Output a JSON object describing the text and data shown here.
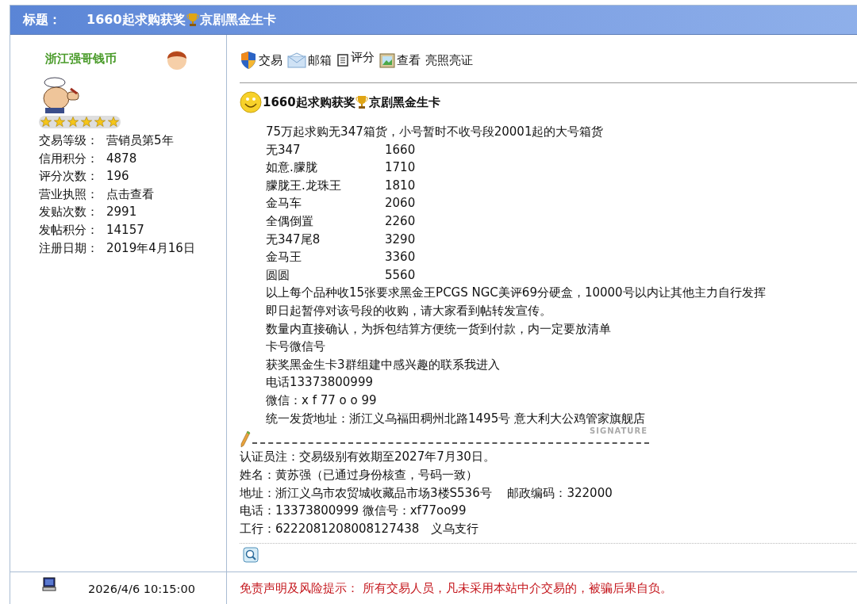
{
  "title_bar": {
    "label": "标题：",
    "title_parts": [
      "1660起求购获奖",
      "京剧黑金生卡"
    ]
  },
  "user": {
    "name": "浙江强哥钱币",
    "stars": 6,
    "stats": [
      {
        "label": "交易等级：",
        "value": "营销员第5年"
      },
      {
        "label": "信用积分：",
        "value": "4878"
      },
      {
        "label": "评分次数：",
        "value": "196"
      },
      {
        "label": "营业执照：",
        "value": "点击查看"
      },
      {
        "label": "发贴次数：",
        "value": "2991"
      },
      {
        "label": "发帖积分：",
        "value": "14157"
      },
      {
        "label": "注册日期：",
        "value": "2019年4月16日"
      }
    ]
  },
  "toolbar": [
    {
      "kind": "shield",
      "label": "交易"
    },
    {
      "kind": "mail",
      "label": "邮箱"
    },
    {
      "kind": "note",
      "label": "评分"
    },
    {
      "kind": "picture",
      "label": "查看"
    },
    {
      "kind": "text",
      "label": "亮照亮证"
    }
  ],
  "post": {
    "title_parts": [
      "1660起求购获奖",
      "京剧黑金生卡"
    ],
    "intro": "75万起求购无347箱货，小号暂时不收号段20001起的大号箱货",
    "price_list": [
      {
        "name": "无347",
        "price": "1660"
      },
      {
        "name": "如意.朦胧",
        "price": "1710"
      },
      {
        "name": "朦胧王.龙珠王",
        "price": "1810"
      },
      {
        "name": "金马车",
        "price": "2060"
      },
      {
        "name": "全偶倒置",
        "price": "2260"
      },
      {
        "name": "无347尾8",
        "price": "3290"
      },
      {
        "name": "金马王",
        "price": "3360"
      },
      {
        "name": "圆圆",
        "price": "5560"
      }
    ],
    "notes": [
      "以上每个品种收15张要求黑金王PCGS NGC美评69分硬盒，10000号以内让其他主力自行发挥",
      "即日起暂停对该号段的收购，请大家看到帖转发宣传。",
      "数量内直接确认，为拆包结算方便统一货到付款，内一定要放清单",
      "卡号微信号",
      "获奖黑金生卡3群组建中感兴趣的联系我进入",
      "电话13373800999",
      "微信：x f 77 o o 99",
      "统一发货地址：浙江义乌福田稠州北路1495号 意大利大公鸡管家旗舰店"
    ],
    "signature_label": "SIGNATURE",
    "certification": [
      "认证员注：交易级别有效期至2027年7月30日。",
      "姓名：黄苏强（已通过身份核查，号码一致）",
      "地址：浙江义乌市农贸城收藏品市场3楼S536号　 邮政编码：322000",
      "电话：13373800999  微信号：xf77oo99",
      "工行：6222081208008127438　义乌支行"
    ]
  },
  "footer": {
    "timestamp": "2026/4/6 10:15:00",
    "disclaimer": "免责声明及风险提示： 所有交易人员，凡未采用本站中介交易的，被骗后果自负。"
  }
}
